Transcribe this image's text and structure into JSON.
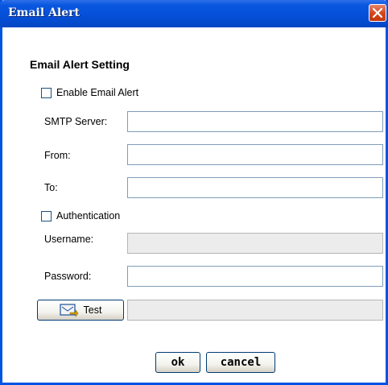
{
  "window": {
    "title": "Email Alert"
  },
  "section": {
    "heading": "Email Alert Setting"
  },
  "enable_alert": {
    "label": "Enable Email Alert",
    "checked": false
  },
  "smtp": {
    "label": "SMTP Server:",
    "value": ""
  },
  "from": {
    "label": "From:",
    "value": ""
  },
  "to": {
    "label": "To:",
    "value": ""
  },
  "auth": {
    "label": "Authentication",
    "checked": false
  },
  "username": {
    "label": "Username:",
    "value": "",
    "disabled": true
  },
  "password": {
    "label": "Password:",
    "value": ""
  },
  "test": {
    "label": "Test",
    "icon": "email-test-icon",
    "result": ""
  },
  "buttons": {
    "ok": "ok",
    "cancel": "cancel"
  }
}
